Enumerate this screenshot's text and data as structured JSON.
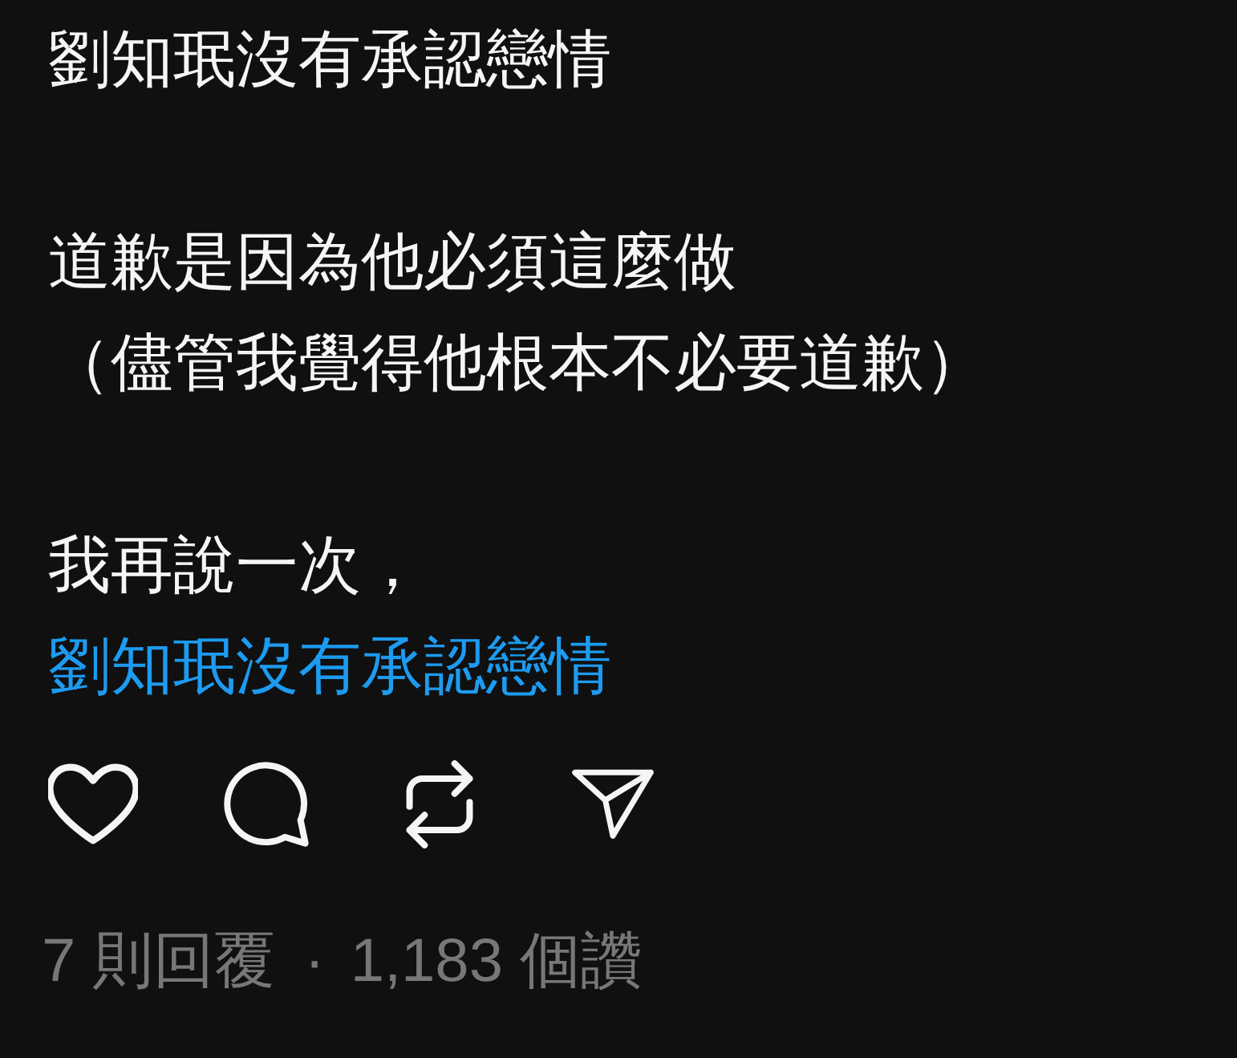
{
  "post": {
    "paragraphs": [
      {
        "lines": [
          "劉知珉沒有承認戀情"
        ]
      },
      {
        "lines": [
          "道歉是因為他必須這麼做",
          "（儘管我覺得他根本不必要道歉）"
        ]
      },
      {
        "lines": [
          "我再說一次，"
        ],
        "link": "劉知珉沒有承認戀情"
      }
    ]
  },
  "stats": {
    "replies": "7 則回覆",
    "separator": "·",
    "likes": "1,183 個讚"
  }
}
